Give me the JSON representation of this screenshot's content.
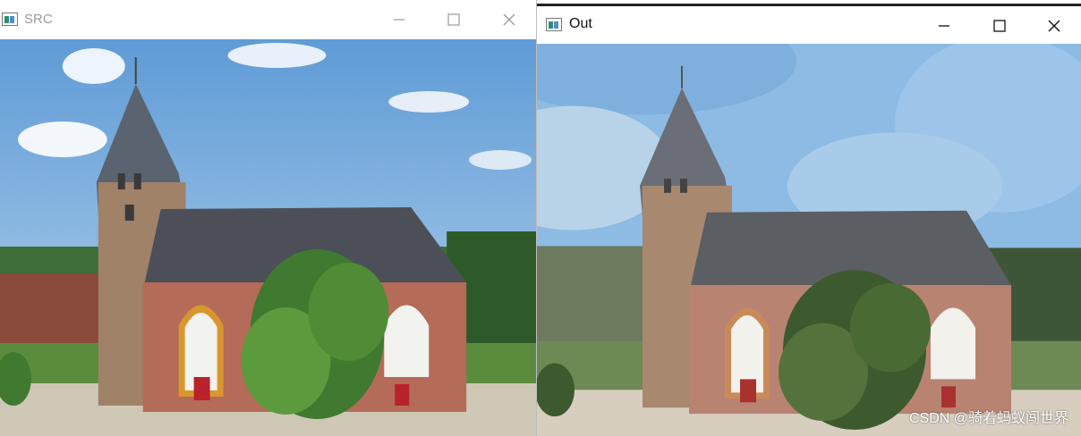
{
  "windows": {
    "src": {
      "title": "SRC",
      "controls": {
        "minimize": "minimize-icon",
        "maximize": "maximize-icon",
        "close": "close-icon"
      },
      "image": "church-photo-original"
    },
    "out": {
      "title": "Out",
      "controls": {
        "minimize": "minimize-icon",
        "maximize": "maximize-icon",
        "close": "close-icon"
      },
      "image": "church-photo-posterized"
    }
  },
  "watermark": "CSDN @骑着蚂蚁闯世界"
}
